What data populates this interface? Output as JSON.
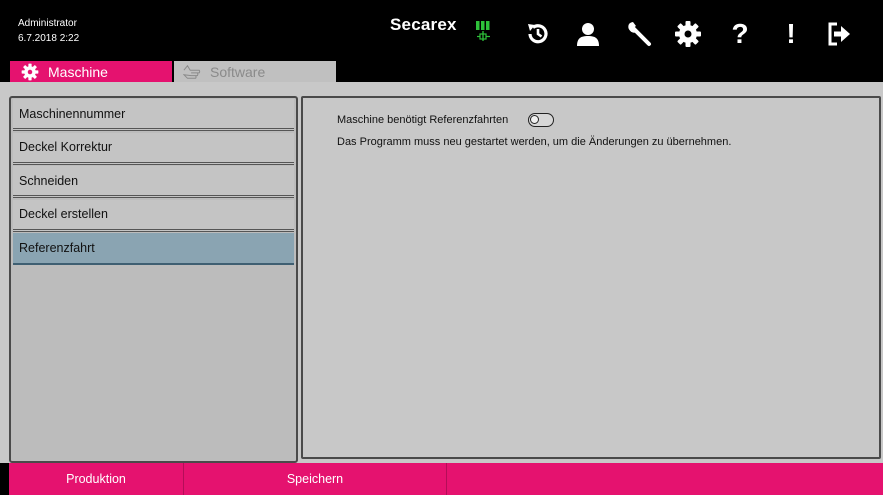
{
  "header": {
    "user_role": "Administrator",
    "datetime": "6.7.2018 2:22",
    "brand": "Secarex",
    "logo_icon": "battery-plug-logo",
    "accent_color": "#e5126f",
    "logo_color": "#2ec13a",
    "toolbar": [
      {
        "name": "history-icon"
      },
      {
        "name": "user-icon"
      },
      {
        "name": "wrench-icon"
      },
      {
        "name": "gear-icon"
      },
      {
        "name": "help-icon",
        "text": "?"
      },
      {
        "name": "alert-icon",
        "text": "!"
      },
      {
        "name": "logout-icon"
      }
    ]
  },
  "tabs": [
    {
      "label": "Maschine",
      "icon": "gear-icon",
      "active": true
    },
    {
      "label": "Software",
      "icon": "hand-icon",
      "active": false
    }
  ],
  "sidebar": {
    "items": [
      {
        "label": "Maschinennummer",
        "active": false
      },
      {
        "label": "Deckel Korrektur",
        "active": false
      },
      {
        "label": "Schneiden",
        "active": false
      },
      {
        "label": "Deckel erstellen",
        "active": false
      },
      {
        "label": "Referenzfahrt",
        "active": true
      }
    ]
  },
  "panel": {
    "setting_label": "Maschine benötigt Referenzfahrten",
    "toggle_on": false,
    "note": "Das Programm muss neu gestartet werden, um die Änderungen zu übernehmen."
  },
  "footer": {
    "produktion": "Produktion",
    "speichern": "Speichern"
  }
}
